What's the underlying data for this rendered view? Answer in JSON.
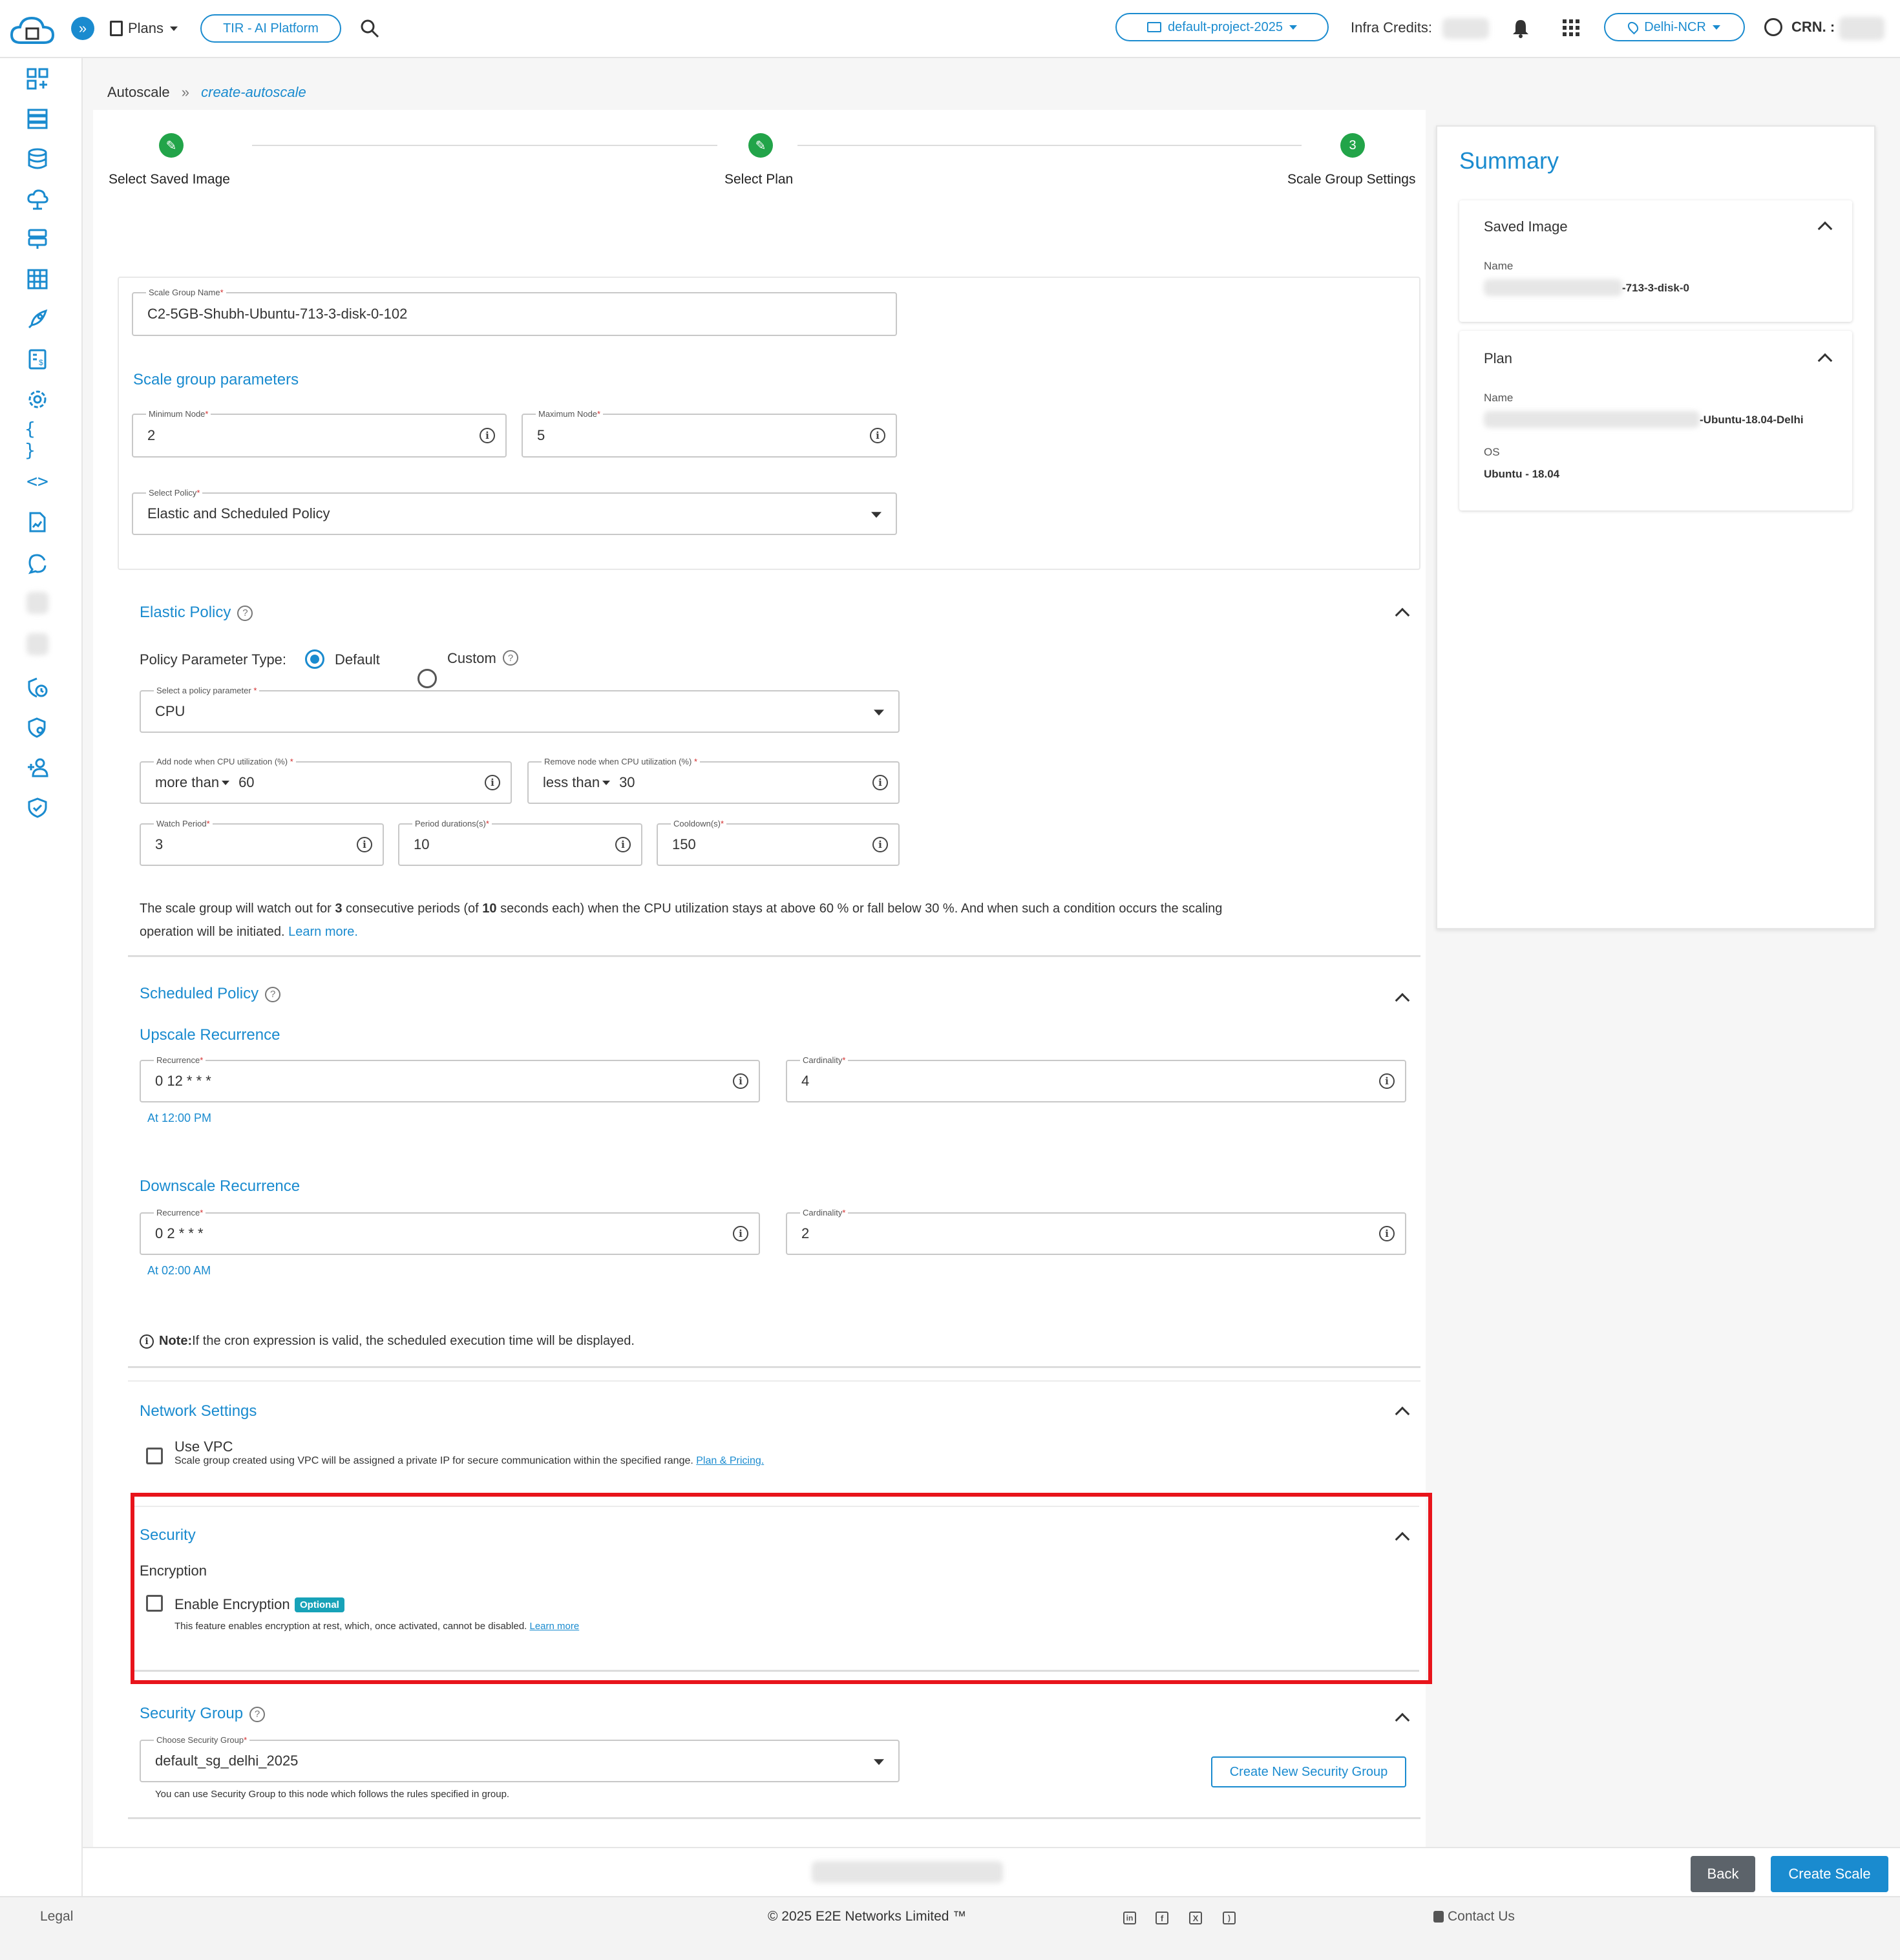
{
  "topbar": {
    "plans_label": "Plans",
    "platform_label": "TIR - AI Platform",
    "project_label": "default-project-2025",
    "infra_credits_label": "Infra Credits:",
    "region_label": "Delhi-NCR",
    "crn_label": "CRN. :"
  },
  "breadcrumb": {
    "root": "Autoscale",
    "sep": "»",
    "current": "create-autoscale"
  },
  "stepper": [
    {
      "label": "Select Saved Image"
    },
    {
      "label": "Select Plan"
    },
    {
      "label": "Scale Group Settings",
      "number": "3"
    }
  ],
  "form": {
    "scale_group_name": {
      "label": "Scale Group Name",
      "req": "*",
      "value": "C2-5GB-Shubh-Ubuntu-713-3-disk-0-102"
    },
    "scale_params_title": "Scale group parameters",
    "min_node": {
      "label": "Minimum Node",
      "req": "*",
      "value": "2"
    },
    "max_node": {
      "label": "Maximum Node",
      "req": "*",
      "value": "5"
    },
    "policy": {
      "label": "Select Policy",
      "req": "*",
      "value": "Elastic and Scheduled Policy"
    }
  },
  "elastic": {
    "title": "Elastic Policy",
    "param_type_label": "Policy Parameter Type:",
    "default_label": "Default",
    "custom_label": "Custom",
    "policy_param": {
      "label": "Select a policy parameter",
      "req": "*",
      "value": "CPU"
    },
    "add_node": {
      "label": "Add node when CPU utilization (%)",
      "req": "*",
      "op": "more than",
      "value": "60"
    },
    "remove_node": {
      "label": "Remove node when CPU utilization (%)",
      "req": "*",
      "op": "less than",
      "value": "30"
    },
    "watch_period": {
      "label": "Watch Period",
      "req": "*",
      "value": "3"
    },
    "period_duration": {
      "label": "Period durations(s)",
      "req": "*",
      "value": "10"
    },
    "cooldown": {
      "label": "Cooldown(s)",
      "req": "*",
      "value": "150"
    },
    "desc_1": "The scale group will watch out for ",
    "desc_periods": "3",
    "desc_2": " consecutive periods (of ",
    "desc_seconds": "10",
    "desc_3": " seconds each) when the CPU utilization stays at above 60 % or fall below 30 %. And when such a condition occurs the scaling",
    "desc_4": "operation will be initiated. ",
    "learn_more": "Learn more."
  },
  "scheduled": {
    "title": "Scheduled Policy",
    "upscale_title": "Upscale Recurrence",
    "up_recurrence": {
      "label": "Recurrence",
      "req": "*",
      "value": "0 12 * * *"
    },
    "up_cardinality": {
      "label": "Cardinality",
      "req": "*",
      "value": "4"
    },
    "up_hint": "At 12:00 PM",
    "downscale_title": "Downscale Recurrence",
    "down_recurrence": {
      "label": "Recurrence",
      "req": "*",
      "value": "0 2 * * *"
    },
    "down_cardinality": {
      "label": "Cardinality",
      "req": "*",
      "value": "2"
    },
    "down_hint": "At 02:00 AM",
    "note_bold": "Note:",
    "note_text": " If the cron expression is valid, the scheduled execution time will be displayed."
  },
  "network": {
    "title": "Network Settings",
    "vpc_label": "Use VPC",
    "vpc_desc": "Scale group created using VPC will be assigned a private IP for secure communication within the specified range. ",
    "vpc_link": "Plan & Pricing."
  },
  "security": {
    "title": "Security",
    "encryption_title": "Encryption",
    "enable_label": "Enable Encryption",
    "optional_badge": "Optional",
    "desc": "This feature enables encryption at rest, which, once activated, cannot be disabled. ",
    "learn_more": "Learn more",
    "highlight_color": "#e8141b"
  },
  "security_group": {
    "title": "Security Group",
    "choose": {
      "label": "Choose Security Group",
      "req": "*",
      "value": "default_sg_delhi_2025"
    },
    "create_button": "Create New Security Group",
    "hint": "You can use Security Group to this node which follows the rules specified in group."
  },
  "summary": {
    "title": "Summary",
    "saved_image_title": "Saved Image",
    "saved_image_name_label": "Name",
    "saved_image_name_suffix": "-713-3-disk-0",
    "plan_title": "Plan",
    "plan_name_label": "Name",
    "plan_name_suffix": "-Ubuntu-18.04-Delhi",
    "os_label": "OS",
    "os_value": "Ubuntu - 18.04"
  },
  "actions": {
    "back": "Back",
    "create": "Create Scale"
  },
  "footer": {
    "legal": "Legal",
    "copyright": "© 2025 E2E Networks Limited ™",
    "contact": "Contact Us"
  },
  "colors": {
    "accent": "#1a8bcf",
    "success": "#22a449",
    "highlight": "#e8141b",
    "back_button": "#5c636a",
    "badge": "#17a2b8"
  }
}
